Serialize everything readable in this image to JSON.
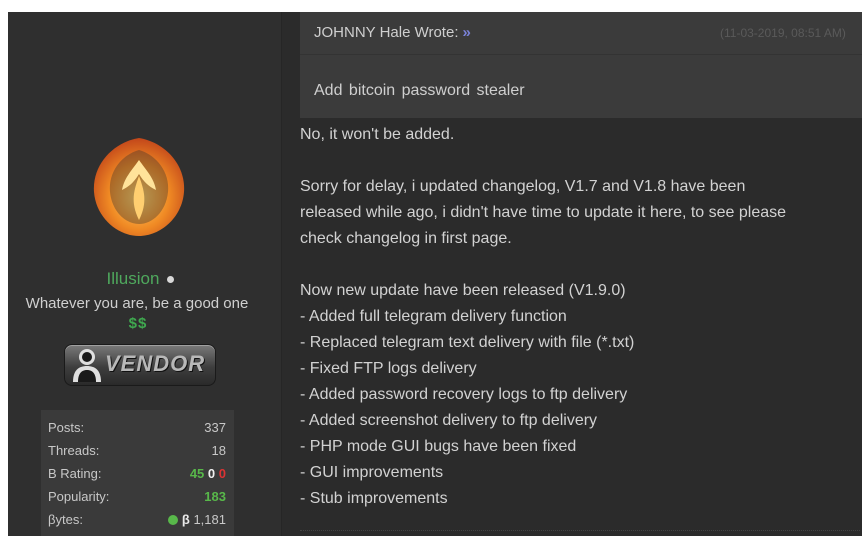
{
  "profile": {
    "username": "Illusion",
    "user_title": "Whatever you are, be a good one",
    "stars": "$$",
    "badge_text": "VENDOR",
    "badge_icon": "person-silhouette-icon",
    "avatar_icon": "phoenix-logo-icon",
    "colors": {
      "username": "#4fa85d",
      "positive": "#58b84a",
      "negative": "#dd3333"
    }
  },
  "stats": {
    "posts_label": "Posts:",
    "posts_value": "337",
    "threads_label": "Threads:",
    "threads_value": "18",
    "rating_label": "B Rating:",
    "rating_positive": "45",
    "rating_neutral": "0",
    "rating_negative": "0",
    "popularity_label": "Popularity:",
    "popularity_value": "183",
    "bytes_label": "βytes:",
    "bytes_symbol": "β",
    "bytes_value": "1,181"
  },
  "quote": {
    "author_line": "JOHNNY Hale Wrote:",
    "arrow": "»",
    "date": "(11-03-2019, 08:51 AM)",
    "body": "Add bitcoin  password  stealer"
  },
  "post": {
    "lines": [
      "No, it won't be added.",
      "",
      "Sorry for delay, i updated changelog, V1.7 and V1.8 have been",
      "released while ago, i didn't have time to update it here, to see please",
      "check changelog in first page.",
      "",
      "Now new update have been released (V1.9.0)",
      "- Added full telegram delivery function",
      "- Replaced telegram text delivery with file (*.txt)",
      "- Fixed FTP logs delivery",
      "- Added password recovery logs to ftp delivery",
      "- Added screenshot delivery to ftp delivery",
      "- PHP mode GUI bugs have been fixed",
      "- GUI improvements",
      "- Stub improvements"
    ]
  }
}
